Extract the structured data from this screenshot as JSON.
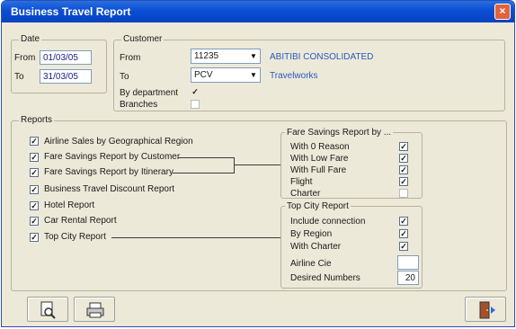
{
  "window": {
    "title": "Business Travel Report",
    "close_label": "×"
  },
  "date_group": {
    "label": "Date",
    "from_label": "From",
    "from_value": "01/03/05",
    "to_label": "To",
    "to_value": "31/03/05"
  },
  "customer_group": {
    "label": "Customer",
    "from_label": "From",
    "from_value": "11235",
    "from_name": "ABITIBI CONSOLIDATED",
    "to_label": "To",
    "to_value": "PCV",
    "to_name": "Travelworks",
    "by_department_label": "By department",
    "by_department_checked": true,
    "branches_label": "Branches",
    "branches_checked": false,
    "dropdown_icon": "chevron-down-icon"
  },
  "reports_group": {
    "label": "Reports",
    "items": [
      {
        "label": "Airline Sales by Geographical Region",
        "checked": true
      },
      {
        "label": "Fare Savings Report by Customer",
        "checked": true
      },
      {
        "label": "Fare Savings Report by Itinerary",
        "checked": true
      },
      {
        "label": "Business Travel Discount Report",
        "checked": true
      },
      {
        "label": "Hotel Report",
        "checked": true
      },
      {
        "label": "Car Rental Report",
        "checked": true
      },
      {
        "label": "Top City Report",
        "checked": true
      }
    ]
  },
  "fare_savings_group": {
    "label": "Fare Savings Report by ...",
    "items": [
      {
        "label": "With 0 Reason",
        "checked": true
      },
      {
        "label": "With Low Fare",
        "checked": true
      },
      {
        "label": "With Full Fare",
        "checked": true
      },
      {
        "label": "Flight",
        "checked": true
      },
      {
        "label": "Charter",
        "checked": false
      }
    ]
  },
  "top_city_group": {
    "label": "Top City Report",
    "items": [
      {
        "label": "Include connection",
        "checked": true
      },
      {
        "label": "By Region",
        "checked": true
      },
      {
        "label": "With Charter",
        "checked": true
      }
    ],
    "airline_cie_label": "Airline Cie",
    "airline_cie_value": "",
    "desired_numbers_label": "Desired Numbers",
    "desired_numbers_value": "20"
  },
  "toolbar": {
    "preview_icon": "print-preview-icon",
    "print_icon": "printer-icon",
    "exit_icon": "exit-door-icon"
  },
  "check_mark": "✓"
}
